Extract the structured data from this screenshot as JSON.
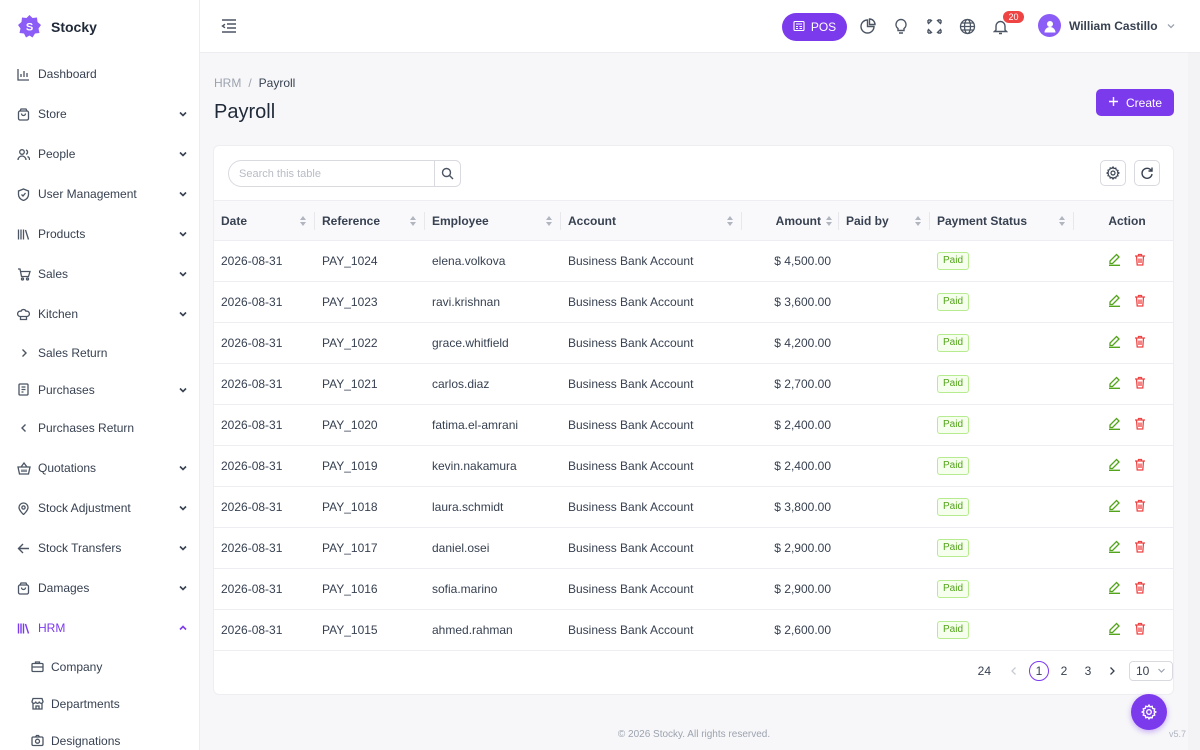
{
  "app": {
    "name": "Stocky",
    "logo_letter": "S",
    "accent": "#7c3aed"
  },
  "sidebar": {
    "items": [
      {
        "label": "Dashboard",
        "icon": "bar-chart-icon",
        "expandable": false
      },
      {
        "label": "Store",
        "icon": "bag-icon",
        "expandable": true
      },
      {
        "label": "People",
        "icon": "users-icon",
        "expandable": true
      },
      {
        "label": "User Management",
        "icon": "shield-check-icon",
        "expandable": true
      },
      {
        "label": "Products",
        "icon": "books-icon",
        "expandable": true
      },
      {
        "label": "Sales",
        "icon": "cart-icon",
        "expandable": true
      },
      {
        "label": "Kitchen",
        "icon": "chef-hat-icon",
        "expandable": true
      },
      {
        "label": "Sales Return",
        "icon": "chevron-right-icon",
        "expandable": false
      },
      {
        "label": "Purchases",
        "icon": "receipt-icon",
        "expandable": true
      },
      {
        "label": "Purchases Return",
        "icon": "chevron-left-icon",
        "expandable": false
      },
      {
        "label": "Quotations",
        "icon": "basket-icon",
        "expandable": true
      },
      {
        "label": "Stock Adjustment",
        "icon": "location-pin-icon",
        "expandable": true
      },
      {
        "label": "Stock Transfers",
        "icon": "arrow-left-icon",
        "expandable": true
      },
      {
        "label": "Damages",
        "icon": "bag-icon",
        "expandable": true
      },
      {
        "label": "HRM",
        "icon": "library-icon",
        "expandable": true,
        "active": true
      }
    ],
    "hrm_sub": [
      {
        "label": "Company",
        "icon": "briefcase-icon"
      },
      {
        "label": "Departments",
        "icon": "store-icon"
      },
      {
        "label": "Designations",
        "icon": "camera-icon"
      }
    ]
  },
  "topbar": {
    "pos_label": "POS",
    "notification_count": "20",
    "user_name": "William Castillo"
  },
  "breadcrumb": {
    "parent": "HRM",
    "separator": "/",
    "current": "Payroll"
  },
  "page": {
    "title": "Payroll",
    "create_label": "Create"
  },
  "search": {
    "placeholder": "Search this table",
    "value": ""
  },
  "table": {
    "columns": [
      "Date",
      "Reference",
      "Employee",
      "Account",
      "Amount",
      "Paid by",
      "Payment Status",
      "Action"
    ],
    "rows": [
      {
        "date": "2026-08-31",
        "reference": "PAY_1024",
        "employee": "elena.volkova",
        "account": "Business Bank Account",
        "amount": "$ 4,500.00",
        "paid_by": "",
        "status": "Paid"
      },
      {
        "date": "2026-08-31",
        "reference": "PAY_1023",
        "employee": "ravi.krishnan",
        "account": "Business Bank Account",
        "amount": "$ 3,600.00",
        "paid_by": "",
        "status": "Paid"
      },
      {
        "date": "2026-08-31",
        "reference": "PAY_1022",
        "employee": "grace.whitfield",
        "account": "Business Bank Account",
        "amount": "$ 4,200.00",
        "paid_by": "",
        "status": "Paid"
      },
      {
        "date": "2026-08-31",
        "reference": "PAY_1021",
        "employee": "carlos.diaz",
        "account": "Business Bank Account",
        "amount": "$ 2,700.00",
        "paid_by": "",
        "status": "Paid"
      },
      {
        "date": "2026-08-31",
        "reference": "PAY_1020",
        "employee": "fatima.el-amrani",
        "account": "Business Bank Account",
        "amount": "$ 2,400.00",
        "paid_by": "",
        "status": "Paid"
      },
      {
        "date": "2026-08-31",
        "reference": "PAY_1019",
        "employee": "kevin.nakamura",
        "account": "Business Bank Account",
        "amount": "$ 2,400.00",
        "paid_by": "",
        "status": "Paid"
      },
      {
        "date": "2026-08-31",
        "reference": "PAY_1018",
        "employee": "laura.schmidt",
        "account": "Business Bank Account",
        "amount": "$ 3,800.00",
        "paid_by": "",
        "status": "Paid"
      },
      {
        "date": "2026-08-31",
        "reference": "PAY_1017",
        "employee": "daniel.osei",
        "account": "Business Bank Account",
        "amount": "$ 2,900.00",
        "paid_by": "",
        "status": "Paid"
      },
      {
        "date": "2026-08-31",
        "reference": "PAY_1016",
        "employee": "sofia.marino",
        "account": "Business Bank Account",
        "amount": "$ 2,900.00",
        "paid_by": "",
        "status": "Paid"
      },
      {
        "date": "2026-08-31",
        "reference": "PAY_1015",
        "employee": "ahmed.rahman",
        "account": "Business Bank Account",
        "amount": "$ 2,600.00",
        "paid_by": "",
        "status": "Paid"
      }
    ]
  },
  "pagination": {
    "total": "24",
    "pages": [
      "1",
      "2",
      "3"
    ],
    "current": "1",
    "page_size": "10"
  },
  "footer": {
    "copyright": "© 2026 Stocky. All rights reserved.",
    "version": "v5.7"
  }
}
